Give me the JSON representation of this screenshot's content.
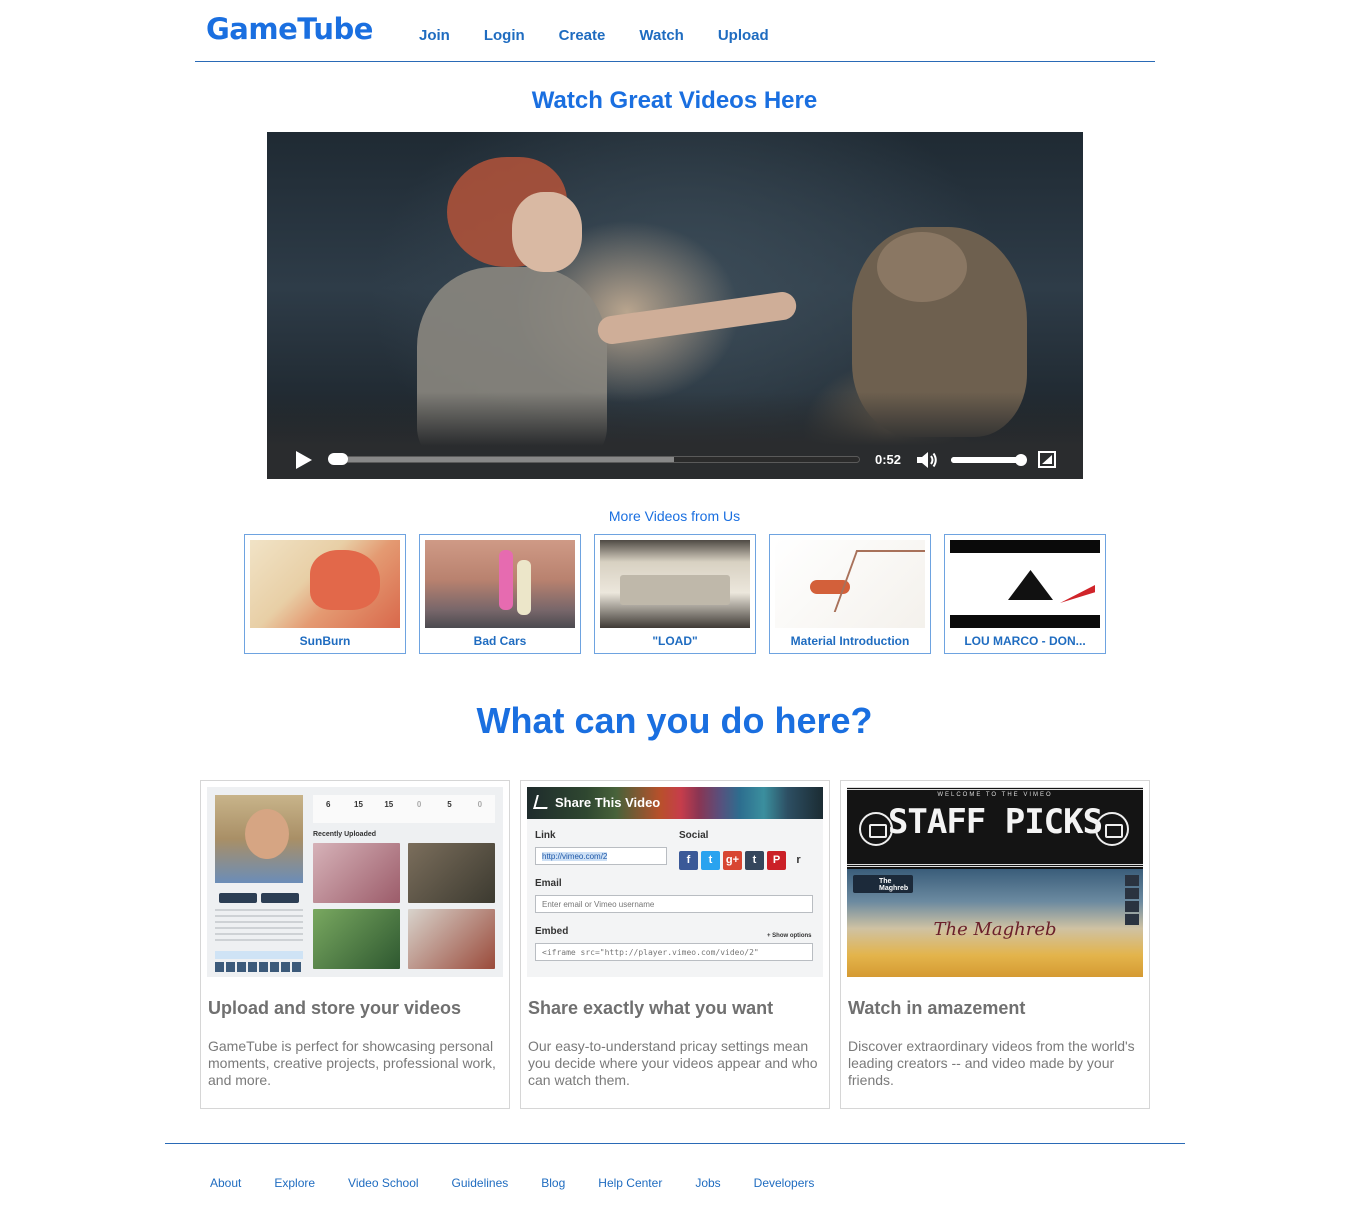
{
  "header": {
    "logo": "GameTube",
    "nav": [
      "Join",
      "Login",
      "Create",
      "Watch",
      "Upload"
    ]
  },
  "hero": {
    "title": "Watch Great Videos Here",
    "player": {
      "time": "0:52",
      "progress_fraction": 0.02,
      "buffered_fraction": 0.65,
      "volume_fraction": 0.95
    }
  },
  "more_videos": {
    "title": "More Videos from Us",
    "items": [
      "SunBurn",
      "Bad Cars",
      "\"LOAD\"",
      "Material Introduction",
      "LOU MARCO - DON..."
    ]
  },
  "features": {
    "title": "What can you do here?",
    "cards": [
      {
        "heading": "Upload and store your videos",
        "text": "GameTube is perfect for showcasing personal moments, creative projects, professional work, and more.",
        "image": {
          "stats": [
            "6",
            "15",
            "15",
            "0",
            "5",
            "0"
          ],
          "section_label": "Recently Uploaded"
        }
      },
      {
        "heading": "Share exactly what you want",
        "text": "Our easy-to-understand pricay settings mean you decide where your videos appear and who can watch them.",
        "image": {
          "bar_title": "Share This Video",
          "link_label": "Link",
          "link_value": "http://vimeo.com/2",
          "social_label": "Social",
          "social_icons": [
            "f",
            "t",
            "g+",
            "t",
            "P",
            "r"
          ],
          "email_label": "Email",
          "email_placeholder": "Enter email or Vimeo username",
          "embed_label": "Embed",
          "show_options": "+ Show options",
          "embed_value": "<iframe src=\"http://player.vimeo.com/video/2\""
        }
      },
      {
        "heading": "Watch in amazement",
        "text": "Discover extraordinary videos from the world's leading creators -- and video made by your friends.",
        "image": {
          "top_text": "WELCOME TO THE VIMEO",
          "title": "STAFF PICKS",
          "badge": "The Maghreb",
          "script": "The Maghreb"
        }
      }
    ]
  },
  "footer": {
    "links": [
      "About",
      "Explore",
      "Video School",
      "Guidelines",
      "Blog",
      "Help Center",
      "Jobs",
      "Developers"
    ]
  },
  "colors": {
    "accent": "#1a6fe0",
    "link": "#1f6cc0",
    "rule": "#2a6ab6",
    "muted_text": "#7a7a7a"
  }
}
